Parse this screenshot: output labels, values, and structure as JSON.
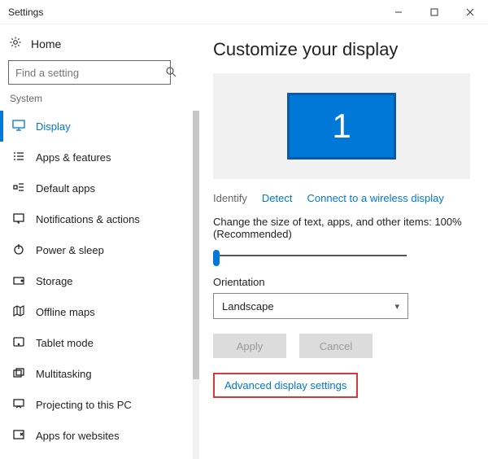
{
  "window": {
    "title": "Settings"
  },
  "home": {
    "label": "Home"
  },
  "search": {
    "placeholder": "Find a setting"
  },
  "sidebar": {
    "section": "System",
    "items": [
      {
        "label": "Display",
        "active": true
      },
      {
        "label": "Apps & features"
      },
      {
        "label": "Default apps"
      },
      {
        "label": "Notifications & actions"
      },
      {
        "label": "Power & sleep"
      },
      {
        "label": "Storage"
      },
      {
        "label": "Offline maps"
      },
      {
        "label": "Tablet mode"
      },
      {
        "label": "Multitasking"
      },
      {
        "label": "Projecting to this PC"
      },
      {
        "label": "Apps for websites"
      }
    ]
  },
  "main": {
    "heading": "Customize your display",
    "monitor_number": "1",
    "links": {
      "identify": "Identify",
      "detect": "Detect",
      "wireless": "Connect to a wireless display"
    },
    "scale_label": "Change the size of text, apps, and other items: 100% (Recommended)",
    "orientation_label": "Orientation",
    "orientation_value": "Landscape",
    "apply": "Apply",
    "cancel": "Cancel",
    "advanced": "Advanced display settings"
  }
}
